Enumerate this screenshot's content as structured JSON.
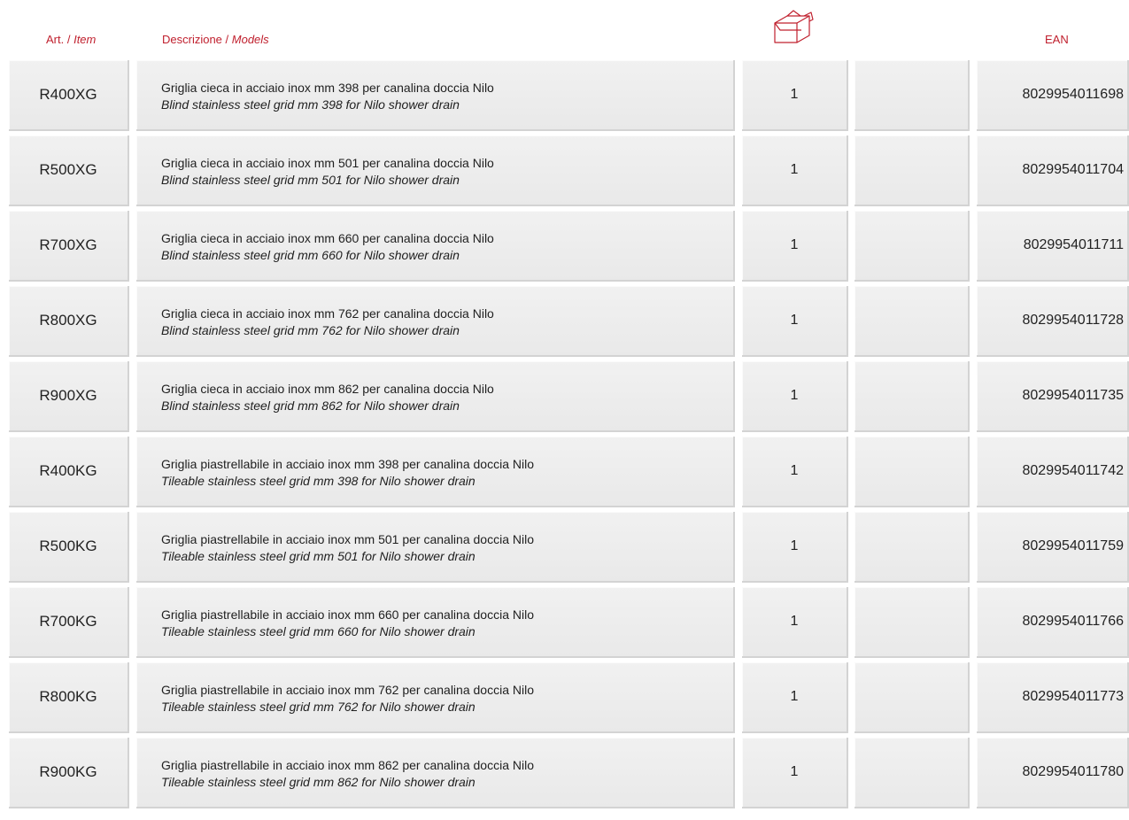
{
  "header": {
    "art_label": "Art. /",
    "art_label_italic": "Item",
    "desc_label": "Descrizione /",
    "desc_label_italic": "Models",
    "package_icon": "box-icon",
    "ean_label": "EAN",
    "accent_color": "#c0202e"
  },
  "rows": [
    {
      "art": "R400XG",
      "desc_it": "Griglia cieca in acciaio inox mm 398 per canalina doccia Nilo",
      "desc_en": "Blind stainless steel grid mm 398 for Nilo shower drain",
      "qty": "1",
      "ean": "8029954011698"
    },
    {
      "art": "R500XG",
      "desc_it": "Griglia cieca in acciaio inox mm 501 per canalina doccia Nilo",
      "desc_en": "Blind stainless steel grid mm 501 for Nilo shower drain",
      "qty": "1",
      "ean": "8029954011704"
    },
    {
      "art": "R700XG",
      "desc_it": "Griglia cieca in acciaio inox mm 660 per canalina doccia Nilo",
      "desc_en": "Blind stainless steel grid mm 660 for Nilo shower drain",
      "qty": "1",
      "ean": "8029954011711"
    },
    {
      "art": "R800XG",
      "desc_it": "Griglia cieca in acciaio inox mm 762 per canalina doccia Nilo",
      "desc_en": "Blind stainless steel grid mm 762 for Nilo shower drain",
      "qty": "1",
      "ean": "8029954011728"
    },
    {
      "art": "R900XG",
      "desc_it": "Griglia cieca in acciaio inox mm 862 per canalina doccia Nilo",
      "desc_en": "Blind stainless steel grid mm 862 for Nilo shower drain",
      "qty": "1",
      "ean": "8029954011735"
    },
    {
      "art": "R400KG",
      "desc_it": "Griglia piastrellabile in acciaio inox mm 398 per canalina doccia Nilo",
      "desc_en": "Tileable stainless steel grid mm 398 for Nilo shower drain",
      "qty": "1",
      "ean": "8029954011742"
    },
    {
      "art": "R500KG",
      "desc_it": "Griglia piastrellabile in acciaio inox mm 501 per canalina doccia Nilo",
      "desc_en": "Tileable stainless steel grid mm 501 for Nilo shower drain",
      "qty": "1",
      "ean": "8029954011759"
    },
    {
      "art": "R700KG",
      "desc_it": "Griglia piastrellabile in acciaio inox mm 660 per canalina doccia Nilo",
      "desc_en": "Tileable stainless steel grid mm 660 for Nilo shower drain",
      "qty": "1",
      "ean": "8029954011766"
    },
    {
      "art": "R800KG",
      "desc_it": "Griglia piastrellabile in acciaio inox mm 762 per canalina doccia Nilo",
      "desc_en": "Tileable stainless steel grid mm 762 for Nilo shower drain",
      "qty": "1",
      "ean": "8029954011773"
    },
    {
      "art": "R900KG",
      "desc_it": "Griglia piastrellabile in acciaio inox mm 862 per canalina doccia Nilo",
      "desc_en": "Tileable stainless steel grid mm 862 for Nilo shower drain",
      "qty": "1",
      "ean": "8029954011780"
    }
  ]
}
